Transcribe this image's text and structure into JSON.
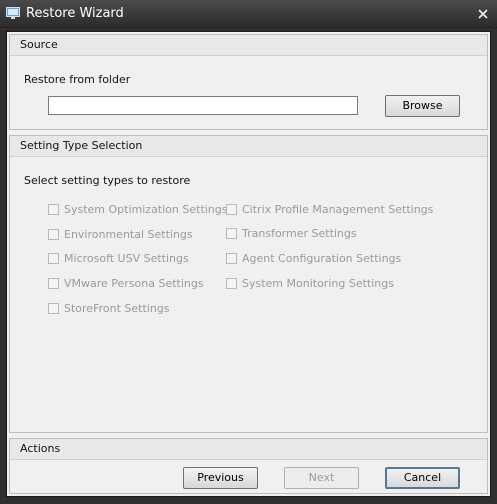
{
  "window": {
    "title": "Restore Wizard"
  },
  "source": {
    "header": "Source",
    "restore_label": "Restore from folder",
    "folder_value": "",
    "browse_label": "Browse"
  },
  "settings": {
    "header": "Setting Type Selection",
    "instruction": "Select setting types to restore",
    "items": [
      {
        "label": "System Optimization Settings",
        "checked": false,
        "enabled": false
      },
      {
        "label": "Citrix Profile Management Settings",
        "checked": false,
        "enabled": false
      },
      {
        "label": "Environmental Settings",
        "checked": false,
        "enabled": false
      },
      {
        "label": "Transformer Settings",
        "checked": false,
        "enabled": false
      },
      {
        "label": "Microsoft USV Settings",
        "checked": false,
        "enabled": false
      },
      {
        "label": "Agent Configuration Settings",
        "checked": false,
        "enabled": false
      },
      {
        "label": "VMware Persona Settings",
        "checked": false,
        "enabled": false
      },
      {
        "label": "System Monitoring Settings",
        "checked": false,
        "enabled": false
      },
      {
        "label": "StoreFront Settings",
        "checked": false,
        "enabled": false
      }
    ]
  },
  "actions": {
    "header": "Actions",
    "previous_label": "Previous",
    "next_label": "Next",
    "cancel_label": "Cancel"
  }
}
